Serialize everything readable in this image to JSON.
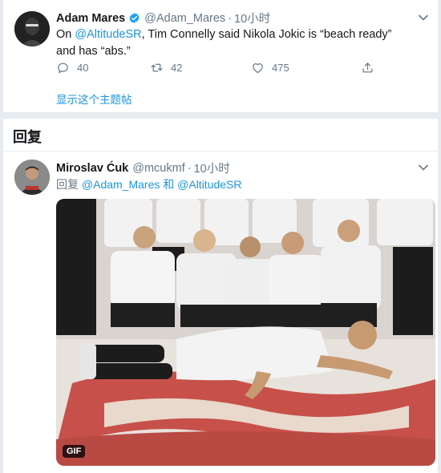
{
  "tweet": {
    "display_name": "Adam Mares",
    "handle": "@Adam_Mares",
    "separator": "·",
    "time": "10小时",
    "text_prefix": "On ",
    "mention": "@AltitudeSR",
    "text_line1_suffix": ", Tim Connelly said Nikola Jokic is  “beach ready”",
    "text_line2": "and has  “abs.”",
    "reply_count": "40",
    "retweet_count": "42",
    "like_count": "475",
    "show_thread": "显示这个主题帖"
  },
  "replies": {
    "title": "回复"
  },
  "reply": {
    "display_name": "Miroslav Ćuk",
    "handle": "@mcukmf",
    "separator": "·",
    "time": "10小时",
    "reply_prefix": "回复 ",
    "reply_to_1": "@Adam_Mares",
    "reply_and": " 和 ",
    "reply_to_2": "@AltitudeSR",
    "media_badge": "GIF"
  },
  "colors": {
    "link": "#1b95e0",
    "muted": "#657786",
    "verified": "#1da1f2"
  },
  "icons": [
    "verified-icon",
    "chevron-down-icon",
    "reply-icon",
    "retweet-icon",
    "like-icon",
    "share-icon"
  ]
}
